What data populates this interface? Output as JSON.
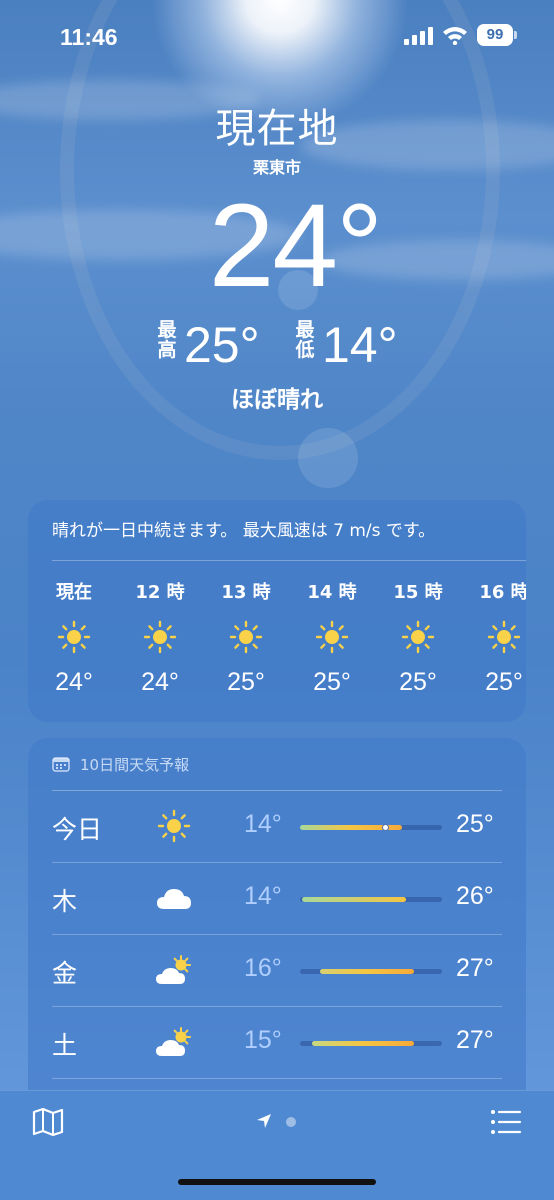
{
  "status_bar": {
    "time": "11:46",
    "battery": "99"
  },
  "current": {
    "location": "現在地",
    "city": "栗東市",
    "temperature": "24°",
    "high_label": "最高",
    "high": "25°",
    "low_label": "最低",
    "low": "14°",
    "condition": "ほぼ晴れ"
  },
  "hourly": {
    "summary": "晴れが一日中続きます。 最大風速は 7 m/s です。",
    "hours": [
      {
        "label": "現在",
        "icon": "sun-icon",
        "temp": "24°"
      },
      {
        "label": "12 時",
        "icon": "sun-icon",
        "temp": "24°"
      },
      {
        "label": "13 時",
        "icon": "sun-icon",
        "temp": "25°"
      },
      {
        "label": "14 時",
        "icon": "sun-icon",
        "temp": "25°"
      },
      {
        "label": "15 時",
        "icon": "sun-icon",
        "temp": "25°"
      },
      {
        "label": "16 時",
        "icon": "sun-icon",
        "temp": "25°"
      }
    ]
  },
  "daily": {
    "title": "10日間天気予報",
    "days": [
      {
        "name": "今日",
        "icon": "sun-icon",
        "low": "14°",
        "high": "25°"
      },
      {
        "name": "木",
        "icon": "cloud-icon",
        "low": "14°",
        "high": "26°"
      },
      {
        "name": "金",
        "icon": "partly-sunny-icon",
        "low": "16°",
        "high": "27°"
      },
      {
        "name": "土",
        "icon": "partly-sunny-icon",
        "low": "15°",
        "high": "27°"
      }
    ]
  },
  "colors": {
    "bar_cool": "#a8d89a",
    "bar_warm": "#f5c542",
    "bar_hot": "#f7a93a"
  }
}
